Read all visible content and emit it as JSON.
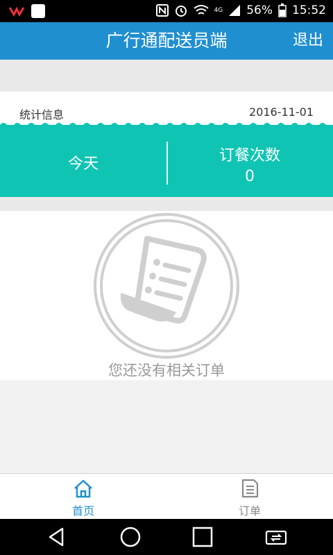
{
  "status_bar": {
    "battery": "56%",
    "time": "15:52",
    "signal_label": "4G"
  },
  "header": {
    "title": "广行通配送员端",
    "logout_label": "退出"
  },
  "stats": {
    "section_label": "统计信息",
    "date": "2016-11-01",
    "today_label": "今天",
    "order_count_label": "订餐次数",
    "order_count_value": "0"
  },
  "empty_state": {
    "message": "您还没有相关订单"
  },
  "bottom_nav": {
    "items": [
      {
        "label": "首页",
        "icon": "home-icon",
        "active": true
      },
      {
        "label": "订单",
        "icon": "orders-icon",
        "active": false
      }
    ]
  },
  "colors": {
    "header_blue": "#1f8fd0",
    "card_teal": "#10c4b3",
    "empty_gray": "#cccccc"
  }
}
